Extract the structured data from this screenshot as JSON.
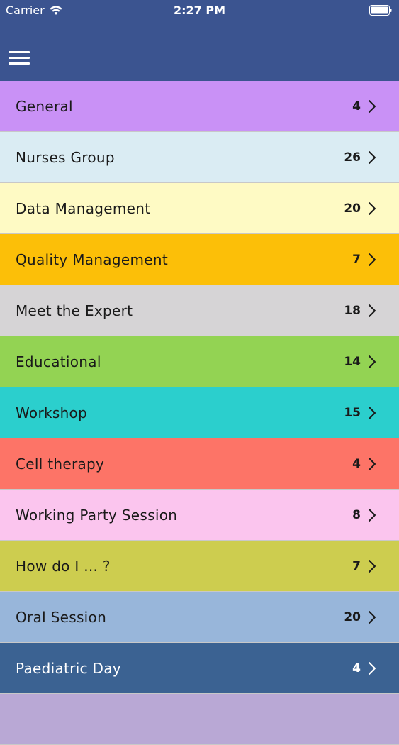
{
  "status": {
    "carrier": "Carrier",
    "time": "2:27 PM"
  },
  "nav": {
    "icon": "hamburger-menu-icon"
  },
  "rows": [
    {
      "label": "General",
      "count": "4",
      "color": "#c991f6"
    },
    {
      "label": "Nurses Group",
      "count": "26",
      "color": "#daecf3"
    },
    {
      "label": "Data Management",
      "count": "20",
      "color": "#fefac4"
    },
    {
      "label": "Quality Management",
      "count": "7",
      "color": "#fcbf08"
    },
    {
      "label": "Meet the Expert",
      "count": "18",
      "color": "#d6d4d6"
    },
    {
      "label": "Educational",
      "count": "14",
      "color": "#93d353"
    },
    {
      "label": "Workshop",
      "count": "15",
      "color": "#2bcfcd"
    },
    {
      "label": "Cell therapy",
      "count": "4",
      "color": "#fd7467"
    },
    {
      "label": "Working Party Session",
      "count": "8",
      "color": "#fbc5ee"
    },
    {
      "label": "How do I ... ?",
      "count": "7",
      "color": "#cdcd4f"
    },
    {
      "label": "Oral Session",
      "count": "20",
      "color": "#98b6da"
    },
    {
      "label": "Paediatric Day",
      "count": "4",
      "color": "#3b6292",
      "dark": true
    },
    {
      "label": "",
      "count": "",
      "color": "#b9a8d5"
    }
  ]
}
